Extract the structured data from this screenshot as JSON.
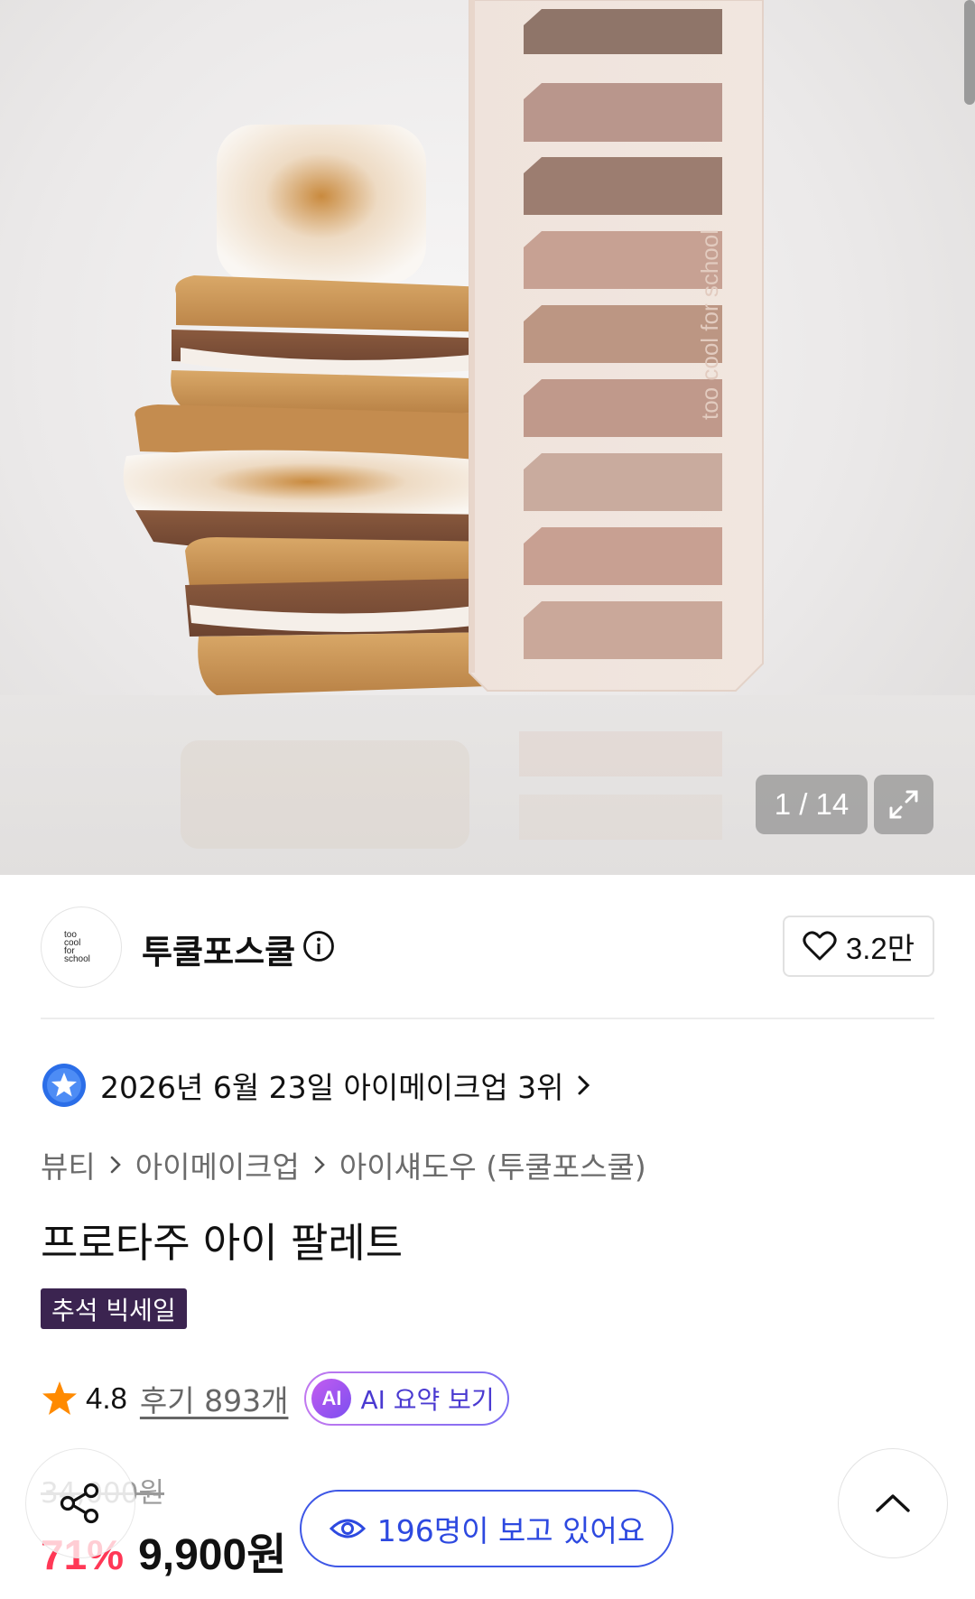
{
  "gallery": {
    "page_indicator": "1 / 14",
    "palette_brand_text": "too cool for school",
    "shade_colors": [
      "#8f7569",
      "#b9968c",
      "#9c7d70",
      "#c7a193",
      "#bc9683",
      "#c0998b",
      "#c9ab9e",
      "#c8a092",
      "#caa89a"
    ]
  },
  "brand": {
    "name": "투쿨포스쿨",
    "logo_text": [
      "too",
      "cool",
      "for",
      "school"
    ],
    "like_count": "3.2만"
  },
  "ranking": {
    "text": "2026년 6월 23일 아이메이크업 3위"
  },
  "breadcrumb": [
    "뷰티",
    "아이메이크업",
    "아이섀도우 (투쿨포스쿨)"
  ],
  "product": {
    "title": "프로타주 아이 팔레트",
    "sale_tag": "추석 빅세일"
  },
  "rating": {
    "score": "4.8",
    "reviews": "후기 893개",
    "ai_badge": "AI",
    "ai_summary": "AI 요약 보기"
  },
  "price": {
    "original": "34,000원",
    "discount": "71%",
    "final": "9,900원"
  },
  "viewers": {
    "text": "196명이 보고 있어요"
  },
  "colors": {
    "accent_blue": "#3e57e6",
    "discount_red": "#ff2e4d",
    "sale_tag_bg": "#3b2450",
    "ai_purple": "#7b4ff0",
    "star_orange": "#ff8a00"
  }
}
